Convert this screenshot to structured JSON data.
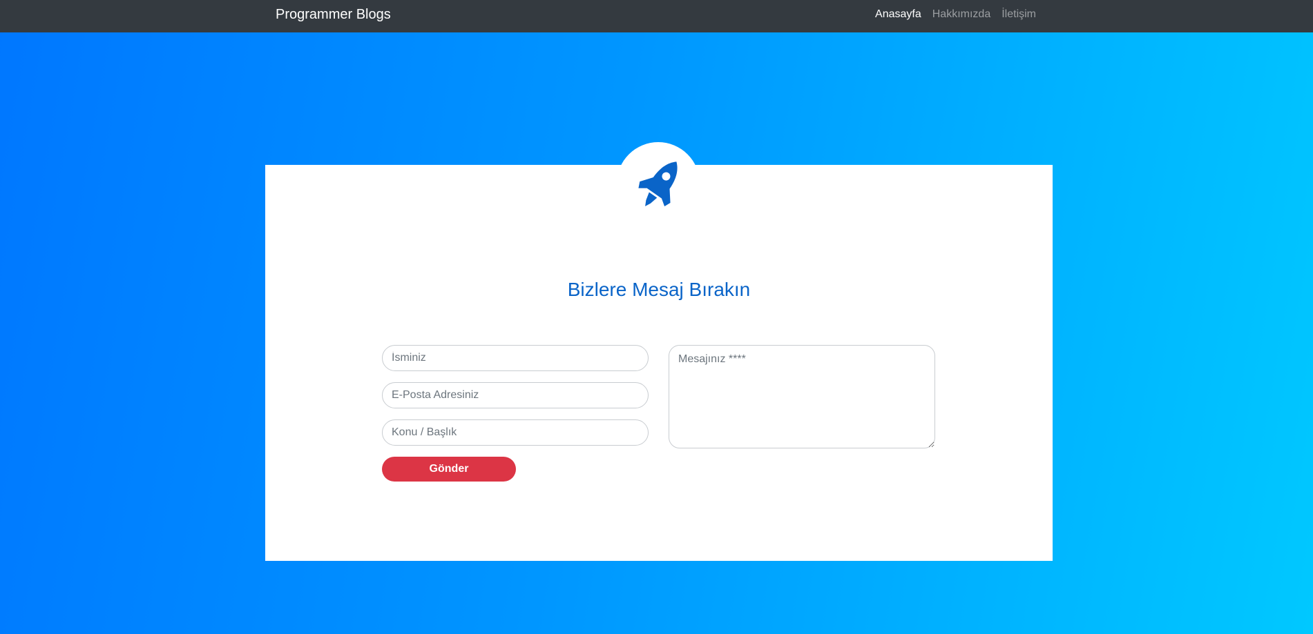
{
  "navbar": {
    "brand": "Programmer Blogs",
    "links": [
      {
        "label": "Anasayfa",
        "active": true
      },
      {
        "label": "Hakkımızda",
        "active": false
      },
      {
        "label": "İletişim",
        "active": false
      }
    ]
  },
  "card": {
    "icon": "rocket-icon",
    "title": "Bizlere Mesaj Bırakın"
  },
  "form": {
    "name_placeholder": "İsminiz",
    "email_placeholder": "E-Posta Adresiniz",
    "subject_placeholder": "Konu / Başlık",
    "message_placeholder": "Mesajınız ****",
    "submit_label": "Gönder"
  },
  "colors": {
    "navbar_bg": "#343a40",
    "gradient_start": "#0077ff",
    "gradient_end": "#00c8ff",
    "title": "#0a64c8",
    "rocket": "#0a64c8",
    "submit_bg": "#dc3545"
  }
}
